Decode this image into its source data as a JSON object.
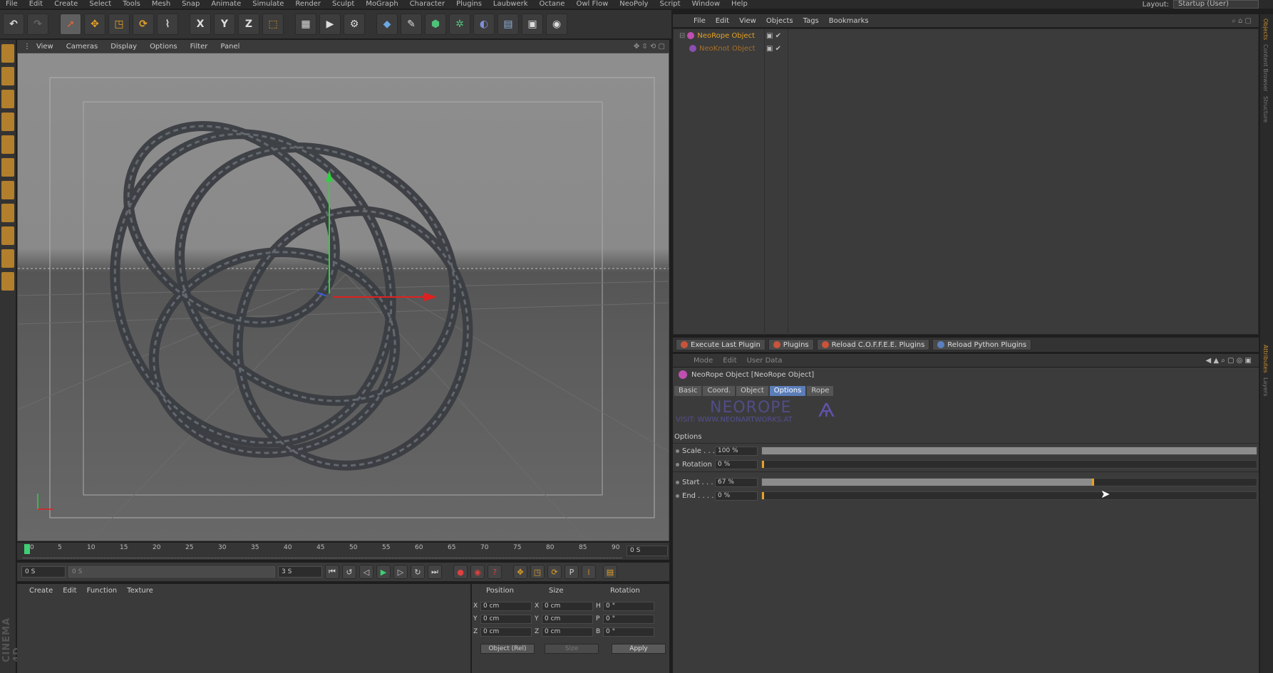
{
  "menubar": {
    "items": [
      "File",
      "Edit",
      "Create",
      "Select",
      "Tools",
      "Mesh",
      "Snap",
      "Animate",
      "Simulate",
      "Render",
      "Sculpt",
      "MoGraph",
      "Character",
      "Plugins",
      "Laubwerk",
      "Octane",
      "Owl Flow",
      "NeoPoly",
      "Script",
      "Window",
      "Help"
    ],
    "layout_label": "Layout:",
    "layout_value": "Startup (User)"
  },
  "toolbar": {
    "axis_x": "X",
    "axis_y": "Y",
    "axis_z": "Z"
  },
  "viewport": {
    "menu": [
      "View",
      "Cameras",
      "Display",
      "Options",
      "Filter",
      "Panel"
    ]
  },
  "timeline": {
    "ticks": [
      "0",
      "5",
      "10",
      "15",
      "20",
      "25",
      "30",
      "35",
      "40",
      "45",
      "50",
      "55",
      "60",
      "65",
      "70",
      "75",
      "80",
      "85",
      "90"
    ],
    "end_field": "0 S"
  },
  "transport": {
    "start_field": "0 S",
    "range_start": "0 S",
    "range_end": "3 S",
    "end_field": "3 S"
  },
  "material_manager": {
    "menu": [
      "Create",
      "Edit",
      "Function",
      "Texture"
    ]
  },
  "coordinates": {
    "headers": {
      "position": "Position",
      "size": "Size",
      "rotation": "Rotation"
    },
    "rows": [
      {
        "axis": "X",
        "pos": "0 cm",
        "size_axis": "X",
        "size": "0 cm",
        "rot_axis": "H",
        "rot": "0 °"
      },
      {
        "axis": "Y",
        "pos": "0 cm",
        "size_axis": "Y",
        "size": "0 cm",
        "rot_axis": "P",
        "rot": "0 °"
      },
      {
        "axis": "Z",
        "pos": "0 cm",
        "size_axis": "Z",
        "size": "0 cm",
        "rot_axis": "B",
        "rot": "0 °"
      }
    ],
    "mode": "Object (Rel)",
    "size_mode": "Size",
    "apply": "Apply"
  },
  "object_manager": {
    "menu": [
      "File",
      "Edit",
      "View",
      "Objects",
      "Tags",
      "Bookmarks"
    ],
    "objects": [
      {
        "name": "NeoRope Object",
        "color": "#e5a126"
      },
      {
        "name": "NeoKnot Object",
        "color": "#a86f2a"
      }
    ]
  },
  "plugin_bar": {
    "buttons": [
      "Execute Last Plugin",
      "Plugins",
      "Reload C.O.F.F.E.E. Plugins",
      "Reload Python Plugins"
    ]
  },
  "attribute_manager": {
    "menu": [
      "Mode",
      "Edit",
      "User Data"
    ],
    "title": "NeoRope Object [NeoRope Object]",
    "tabs": [
      "Basic",
      "Coord.",
      "Object",
      "Options",
      "Rope"
    ],
    "active_tab": "Options",
    "banner_title": "NEOROPE",
    "banner_url": "VISIT: WWW.NEONARTWORKS.AT",
    "section": "Options",
    "params": [
      {
        "label": "Scale . . .",
        "value": "100 %",
        "fraction": 1.0
      },
      {
        "label": "Rotation",
        "value": "0 %",
        "fraction": 0.0
      },
      {
        "label": "Start . . .",
        "value": "67 %",
        "fraction": 0.67
      },
      {
        "label": "End . . . .",
        "value": "0 %",
        "fraction": 0.0
      }
    ]
  },
  "right_strip": {
    "tabs_top": [
      "Objects",
      "Content Browser",
      "Structure"
    ],
    "tabs_bottom": [
      "Attributes",
      "Layers"
    ]
  },
  "branding": {
    "logo_text": "CINEMA 4D"
  },
  "colors": {
    "accent_orange": "#e5a126",
    "tab_active": "#5b7db8",
    "timeline_marker": "#3fcf73"
  }
}
